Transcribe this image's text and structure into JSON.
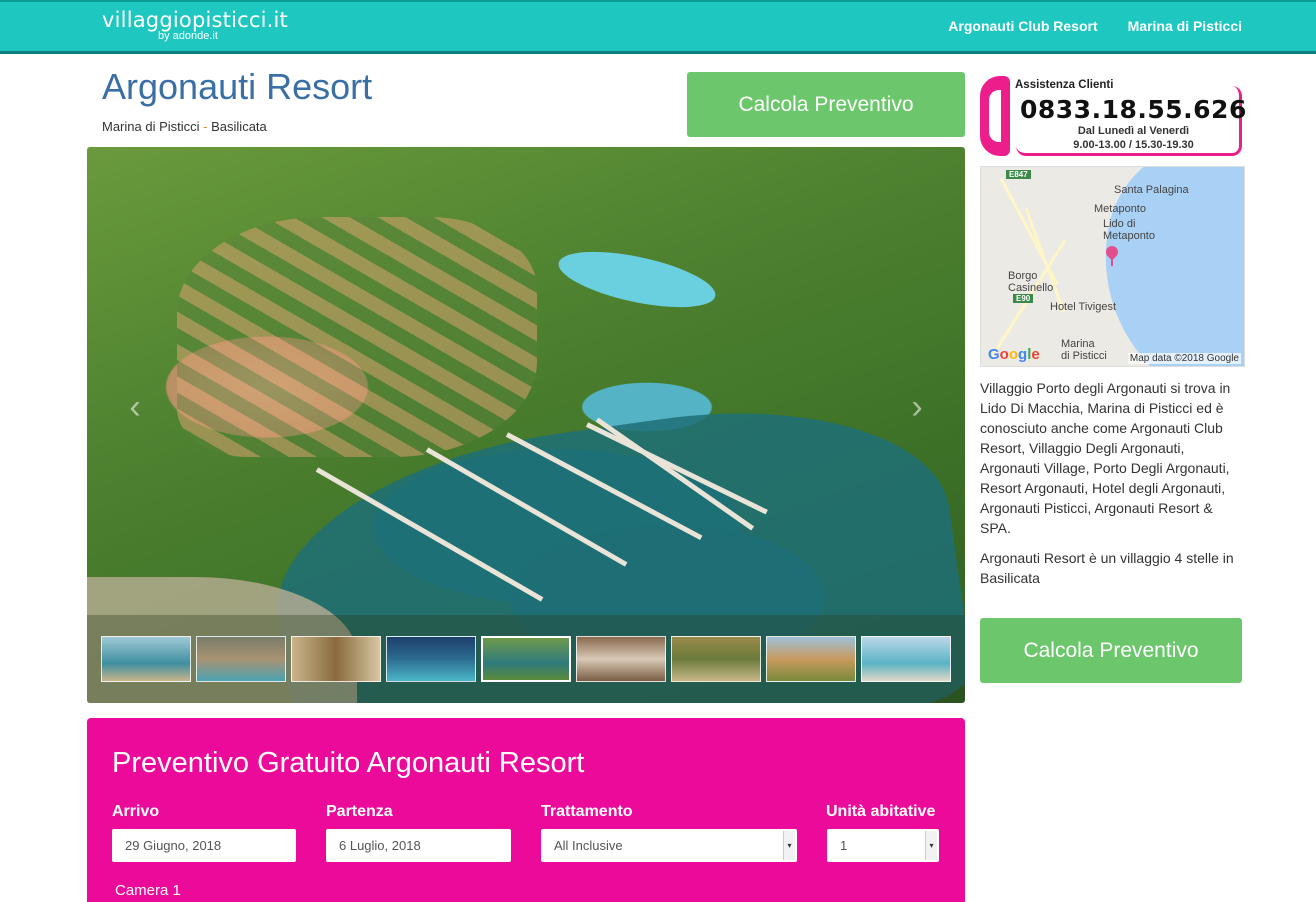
{
  "navbar": {
    "brand_name": "villaggiopisticci.it",
    "brand_sub": "by adonde.it",
    "links": [
      "Argonauti Club Resort",
      "Marina di Pisticci"
    ]
  },
  "header": {
    "title": "Argonauti Resort",
    "location_town": "Marina di Pisticci",
    "location_sep": "-",
    "location_region": "Basilicata",
    "cta_label": "Calcola Preventivo"
  },
  "gallery": {
    "prev_icon": "‹",
    "next_icon": "›",
    "thumb_count": 9,
    "active_thumb": 5
  },
  "quote": {
    "title": "Preventivo Gratuito Argonauti Resort",
    "arrival_label": "Arrivo",
    "arrival_value": "29 Giugno, 2018",
    "departure_label": "Partenza",
    "departure_value": "6 Luglio, 2018",
    "board_label": "Trattamento",
    "board_value": "All Inclusive",
    "units_label": "Unità abitative",
    "units_value": "1",
    "room_label": "Camera 1"
  },
  "assistance": {
    "label": "Assistenza Clienti",
    "phone": "0833.18.55.626",
    "days": "Dal Lunedì al Venerdì",
    "hours": "9.00-13.00 / 15.30-19.30"
  },
  "map": {
    "labels": {
      "santa_palagina": "Santa Palagina",
      "metaponto": "Metaponto",
      "lido": "Lido di\nMetaponto",
      "borgo": "Borgo\nCasinello",
      "tivigest": "Hotel Tivigest",
      "marina": "Marina\ndi Pisticci"
    },
    "shield_e847": "E847",
    "shield_e90": "E90",
    "google": "Google",
    "credit": "Map data ©2018 Google"
  },
  "sidebar": {
    "description_1": "Villaggio Porto degli Argonauti si trova in Lido Di Macchia, Marina di Pisticci ed è conosciuto anche come Argonauti Club Resort, Villaggio Degli Argonauti, Argonauti Village, Porto Degli Argonauti, Resort Argonauti, Hotel degli Argonauti, Argonauti Pisticci, Argonauti Resort & SPA.",
    "description_2": "Argonauti Resort è un villaggio 4 stelle in Basilicata",
    "cta_label": "Calcola Preventivo"
  },
  "colors": {
    "navbar": "#1ec8c0",
    "title": "#3a6fa6",
    "cta": "#6cc76c",
    "quote_bg": "#ec0a9a",
    "assist_accent": "#ec1e8c"
  }
}
